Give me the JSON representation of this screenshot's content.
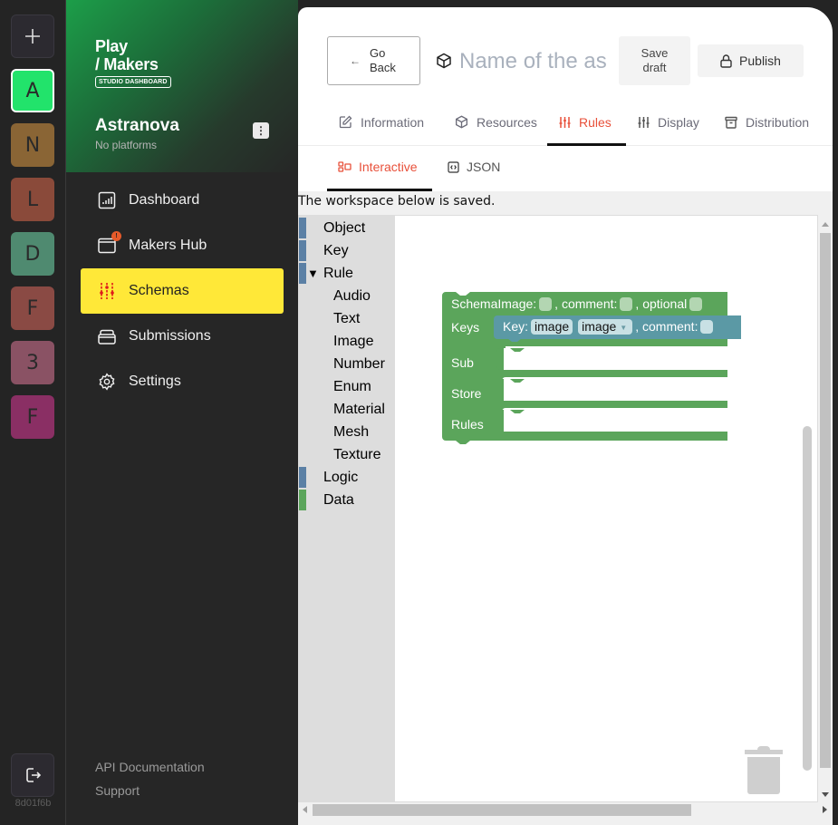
{
  "rail": {
    "add_icon": "plus-icon",
    "orgs": [
      {
        "letter": "A",
        "color": "#22e36b",
        "active": true
      },
      {
        "letter": "N",
        "color": "#8a6535",
        "active": false
      },
      {
        "letter": "L",
        "color": "#8a4a3a",
        "active": false
      },
      {
        "letter": "D",
        "color": "#4f8a70",
        "active": false
      },
      {
        "letter": "F",
        "color": "#8a4a44",
        "active": false
      },
      {
        "letter": "3",
        "color": "#8a5264",
        "active": false
      },
      {
        "letter": "F",
        "color": "#8a2f64",
        "active": false
      }
    ],
    "logout_icon": "logout-icon",
    "build_hash": "8d01f6b"
  },
  "sidebar": {
    "logo_line1": "Play",
    "logo_line2": "/ Makers",
    "logo_badge": "STUDIO DASHBOARD",
    "org_name": "Astranova",
    "org_sub": "No platforms",
    "org_menu_icon": "more-vertical-icon",
    "items": [
      {
        "label": "Dashboard",
        "icon": "bar-chart-icon",
        "active": false
      },
      {
        "label": "Makers Hub",
        "icon": "browser-window-icon",
        "active": false,
        "badge": "!"
      },
      {
        "label": "Schemas",
        "icon": "sliders-icon",
        "active": true
      },
      {
        "label": "Submissions",
        "icon": "inbox-stack-icon",
        "active": false
      },
      {
        "label": "Settings",
        "icon": "gear-icon",
        "active": false
      }
    ],
    "footer_links": [
      "API Documentation",
      "Support"
    ]
  },
  "header": {
    "go_back_label": "Go Back",
    "name_placeholder": "Name of the asset",
    "save_draft_label": "Save draft",
    "publish_label": "Publish"
  },
  "tabs": [
    {
      "label": "Information",
      "icon": "edit-icon",
      "active": false
    },
    {
      "label": "Resources",
      "icon": "cube-icon",
      "active": false
    },
    {
      "label": "Rules",
      "icon": "sliders-icon",
      "active": true
    },
    {
      "label": "Display",
      "icon": "sliders-icon",
      "active": false
    },
    {
      "label": "Distribution",
      "icon": "archive-icon",
      "active": false
    }
  ],
  "subtabs": [
    {
      "label": "Interactive",
      "icon": "blocks-icon",
      "active": true
    },
    {
      "label": "JSON",
      "icon": "code-icon",
      "active": false
    }
  ],
  "workspace": {
    "status_message": "The workspace below is saved.",
    "toolbox": [
      {
        "label": "Object",
        "color": "#5b80a5",
        "level": 0
      },
      {
        "label": "Key",
        "color": "#5b80a5",
        "level": 0
      },
      {
        "label": "Rule",
        "color": "#5b80a5",
        "level": 0,
        "expanded": true
      },
      {
        "label": "Audio",
        "level": 1
      },
      {
        "label": "Text",
        "level": 1
      },
      {
        "label": "Image",
        "level": 1
      },
      {
        "label": "Number",
        "level": 1
      },
      {
        "label": "Enum",
        "level": 1
      },
      {
        "label": "Material",
        "level": 1
      },
      {
        "label": "Mesh",
        "level": 1
      },
      {
        "label": "Texture",
        "level": 1
      },
      {
        "label": "Logic",
        "color": "#5b80a5",
        "level": 0
      },
      {
        "label": "Data",
        "color": "#5ba55b",
        "level": 0
      }
    ],
    "schema_block": {
      "color": "#5ba55b",
      "title_parts": [
        "SchemaImage:",
        ", comment:",
        ", optional"
      ],
      "inputs": [
        "Keys",
        "Sub",
        "Store",
        "Rules"
      ],
      "key_block": {
        "color": "#5b99a5",
        "label": "Key:",
        "name_value": "image",
        "type_value": "image",
        "comment_label": ", comment:"
      }
    },
    "trash_icon": "trash-icon"
  }
}
